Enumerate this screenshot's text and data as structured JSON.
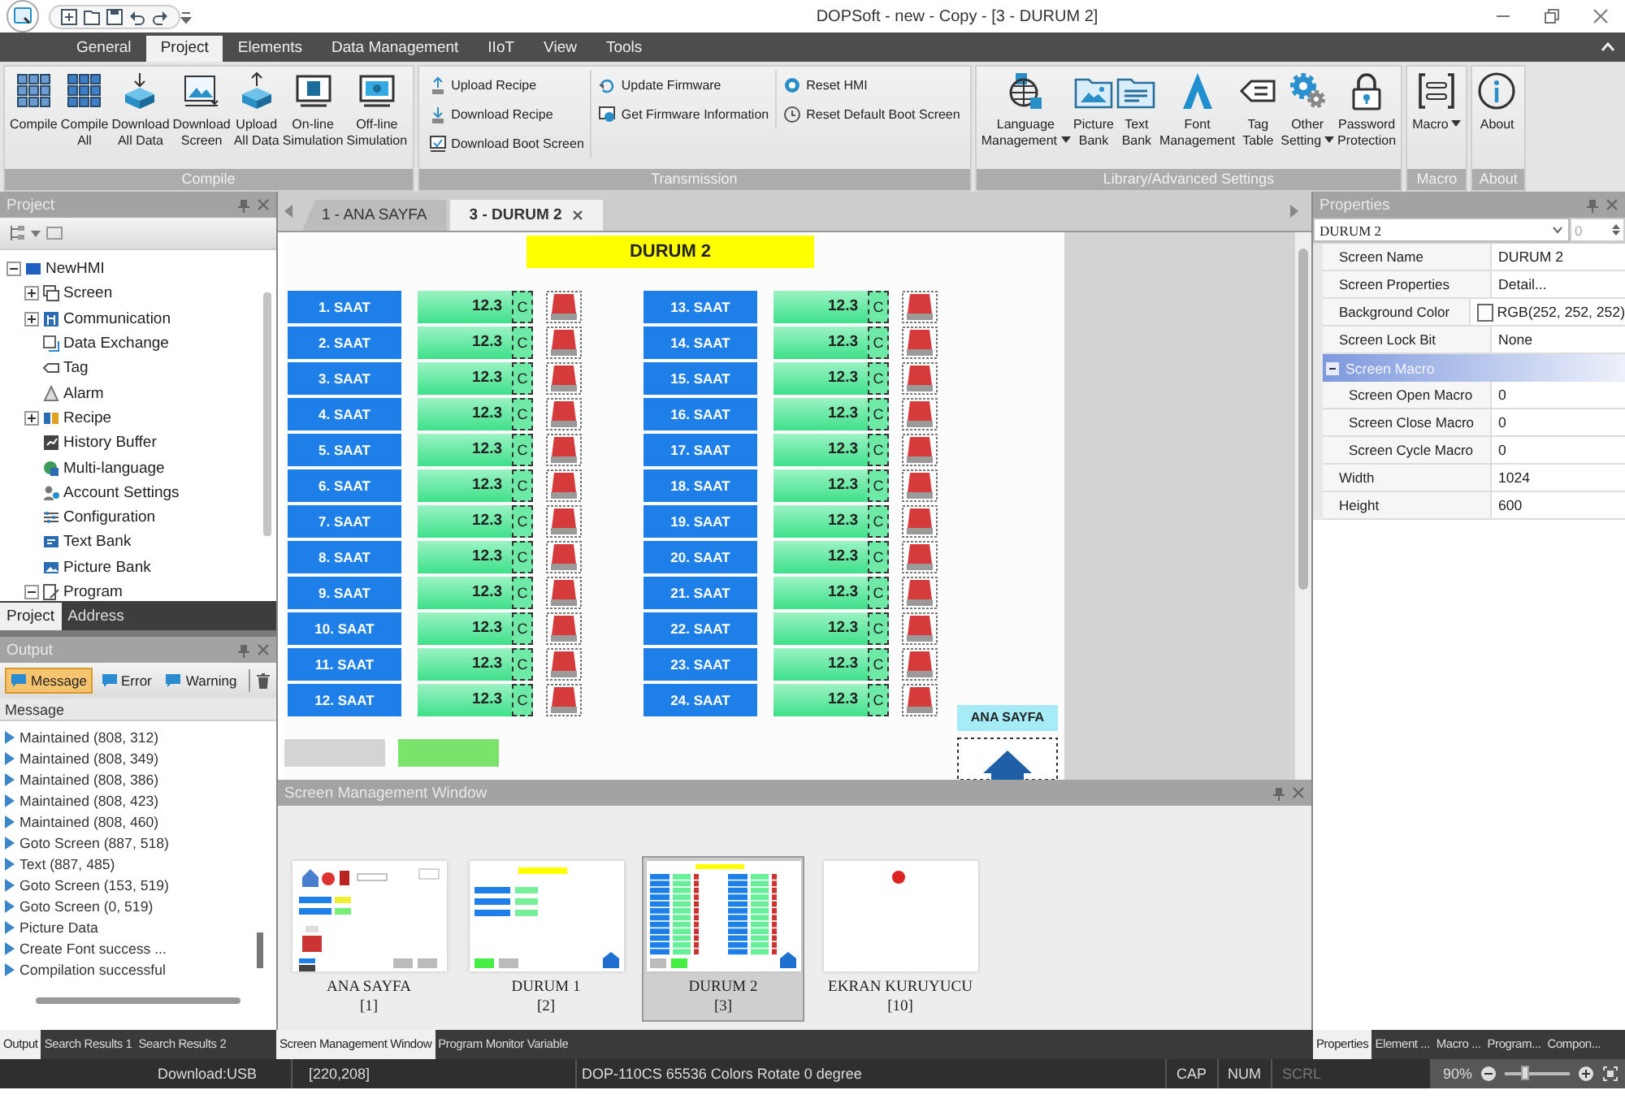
{
  "window": {
    "title": "DOPSoft - new - Copy - [3 - DURUM 2]"
  },
  "menu_tabs": [
    {
      "label": "General",
      "selected": false
    },
    {
      "label": "Project",
      "selected": true
    },
    {
      "label": "Elements",
      "selected": false
    },
    {
      "label": "Data Management",
      "selected": false
    },
    {
      "label": "IIoT",
      "selected": false
    },
    {
      "label": "View",
      "selected": false
    },
    {
      "label": "Tools",
      "selected": false
    }
  ],
  "ribbon": [
    {
      "title": "Compile",
      "kind": "large",
      "buttons": [
        {
          "label": "Compile",
          "dropdown": false
        },
        {
          "label": "Compile\nAll",
          "dropdown": false
        },
        {
          "label": "Download\nAll Data",
          "dropdown": false
        },
        {
          "label": "Download\nScreen",
          "dropdown": false
        },
        {
          "label": "Upload\nAll Data",
          "dropdown": false
        },
        {
          "label": "On-line\nSimulation",
          "dropdown": false
        },
        {
          "label": "Off-line\nSimulation",
          "dropdown": false
        }
      ]
    },
    {
      "title": "Transmission",
      "kind": "small",
      "columns": [
        [
          {
            "label": "Upload Recipe"
          },
          {
            "label": "Download Recipe"
          },
          {
            "label": "Download Boot Screen"
          }
        ],
        [
          {
            "label": "Update Firmware"
          },
          {
            "label": "Get Firmware Information"
          }
        ],
        [
          {
            "label": "Reset HMI"
          },
          {
            "label": "Reset Default Boot Screen"
          }
        ]
      ]
    },
    {
      "title": "Library/Advanced Settings",
      "kind": "large",
      "buttons": [
        {
          "label": "Language\nManagement",
          "dropdown": true
        },
        {
          "label": "Picture\nBank",
          "dropdown": false
        },
        {
          "label": "Text\nBank",
          "dropdown": false
        },
        {
          "label": "Font\nManagement",
          "dropdown": false
        },
        {
          "label": "Tag\nTable",
          "dropdown": false
        },
        {
          "label": "Other\nSetting",
          "dropdown": true
        },
        {
          "label": "Password\nProtection",
          "dropdown": false
        }
      ]
    },
    {
      "title": "Macro",
      "kind": "large",
      "buttons": [
        {
          "label": "Macro",
          "dropdown": true
        }
      ]
    },
    {
      "title": "About",
      "kind": "large",
      "buttons": [
        {
          "label": "About",
          "dropdown": false
        }
      ]
    }
  ],
  "project": {
    "title": "Project",
    "tree": [
      {
        "label": "NewHMI",
        "kind": "folder",
        "expanded": true,
        "children": [
          {
            "label": "Screen",
            "kind": "folder",
            "expanded": false
          },
          {
            "label": "Communication",
            "kind": "folder",
            "expanded": false
          },
          {
            "label": "Data Exchange",
            "kind": "leaf"
          },
          {
            "label": "Tag",
            "kind": "leaf"
          },
          {
            "label": "Alarm",
            "kind": "leaf"
          },
          {
            "label": "Recipe",
            "kind": "folder",
            "expanded": false
          },
          {
            "label": "History Buffer",
            "kind": "leaf"
          },
          {
            "label": "Multi-language",
            "kind": "leaf"
          },
          {
            "label": "Account Settings",
            "kind": "leaf"
          },
          {
            "label": "Configuration",
            "kind": "leaf"
          },
          {
            "label": "Text Bank",
            "kind": "leaf"
          },
          {
            "label": "Picture Bank",
            "kind": "leaf"
          },
          {
            "label": "Program",
            "kind": "folder",
            "expanded": true
          }
        ]
      }
    ]
  },
  "left_tabs": [
    {
      "label": "Project",
      "selected": true
    },
    {
      "label": "Address",
      "selected": false
    }
  ],
  "output": {
    "title": "Output",
    "filters": [
      {
        "label": "Message",
        "selected": true
      },
      {
        "label": "Error",
        "selected": false
      },
      {
        "label": "Warning",
        "selected": false
      }
    ],
    "column": "Message",
    "messages": [
      "Maintained (808, 312)",
      "Maintained (808, 349)",
      "Maintained (808, 386)",
      "Maintained (808, 423)",
      "Maintained (808, 460)",
      "Goto Screen (887, 518)",
      "Text (887, 485)",
      "Goto Screen (153, 519)",
      "Goto Screen (0, 519)",
      "Picture Data",
      "Create Font success ...",
      "Compilation successful"
    ]
  },
  "document_tabs": [
    {
      "label": "1 - ANA SAYFA",
      "selected": false
    },
    {
      "label": "3 - DURUM 2",
      "selected": true
    }
  ],
  "hmi": {
    "title": "DURUM 2",
    "nav_label": "ANA SAYFA",
    "rows": [
      {
        "label": "1. SAAT",
        "value": "12.3",
        "unit": "C"
      },
      {
        "label": "2. SAAT",
        "value": "12.3",
        "unit": "C"
      },
      {
        "label": "3. SAAT",
        "value": "12.3",
        "unit": "C"
      },
      {
        "label": "4. SAAT",
        "value": "12.3",
        "unit": "C"
      },
      {
        "label": "5. SAAT",
        "value": "12.3",
        "unit": "C"
      },
      {
        "label": "6. SAAT",
        "value": "12.3",
        "unit": "C"
      },
      {
        "label": "7. SAAT",
        "value": "12.3",
        "unit": "C"
      },
      {
        "label": "8. SAAT",
        "value": "12.3",
        "unit": "C"
      },
      {
        "label": "9. SAAT",
        "value": "12.3",
        "unit": "C"
      },
      {
        "label": "10. SAAT",
        "value": "12.3",
        "unit": "C"
      },
      {
        "label": "11. SAAT",
        "value": "12.3",
        "unit": "C"
      },
      {
        "label": "12. SAAT",
        "value": "12.3",
        "unit": "C"
      },
      {
        "label": "13. SAAT",
        "value": "12.3",
        "unit": "C"
      },
      {
        "label": "14. SAAT",
        "value": "12.3",
        "unit": "C"
      },
      {
        "label": "15. SAAT",
        "value": "12.3",
        "unit": "C"
      },
      {
        "label": "16. SAAT",
        "value": "12.3",
        "unit": "C"
      },
      {
        "label": "17. SAAT",
        "value": "12.3",
        "unit": "C"
      },
      {
        "label": "18. SAAT",
        "value": "12.3",
        "unit": "C"
      },
      {
        "label": "19. SAAT",
        "value": "12.3",
        "unit": "C"
      },
      {
        "label": "20. SAAT",
        "value": "12.3",
        "unit": "C"
      },
      {
        "label": "21. SAAT",
        "value": "12.3",
        "unit": "C"
      },
      {
        "label": "22. SAAT",
        "value": "12.3",
        "unit": "C"
      },
      {
        "label": "23. SAAT",
        "value": "12.3",
        "unit": "C"
      },
      {
        "label": "24. SAAT",
        "value": "12.3",
        "unit": "C"
      }
    ]
  },
  "screen_manager": {
    "title": "Screen Management Window",
    "screens": [
      {
        "name": "ANA SAYFA",
        "number": "[1]",
        "kind": "home",
        "selected": false
      },
      {
        "name": "DURUM 1",
        "number": "[2]",
        "kind": "list",
        "selected": false
      },
      {
        "name": "DURUM 2",
        "number": "[3]",
        "kind": "grid",
        "selected": true
      },
      {
        "name": "EKRAN KURUYUCU",
        "number": "[10]",
        "kind": "blank",
        "selected": false
      }
    ]
  },
  "properties": {
    "title": "Properties",
    "object": "DURUM 2",
    "spin": "0",
    "rows": [
      {
        "kind": "prop",
        "name": "Screen Name",
        "value": "DURUM 2"
      },
      {
        "kind": "prop",
        "name": "Screen Properties",
        "value": "Detail..."
      },
      {
        "kind": "prop",
        "name": "Background Color",
        "value": "RGB(252, 252, 252)",
        "swatch": true
      },
      {
        "kind": "prop",
        "name": "Screen Lock Bit",
        "value": "None"
      },
      {
        "kind": "category",
        "name": "Screen Macro",
        "expanded": true,
        "children": [
          {
            "name": "Screen Open Macro",
            "value": "0"
          },
          {
            "name": "Screen Close Macro",
            "value": "0"
          },
          {
            "name": "Screen Cycle Macro",
            "value": "0"
          }
        ]
      },
      {
        "kind": "prop",
        "name": "Width",
        "value": "1024"
      },
      {
        "kind": "prop",
        "name": "Height",
        "value": "600"
      }
    ]
  },
  "bottom_tabs": [
    [
      {
        "label": "Output",
        "selected": true
      },
      {
        "label": "Search Results 1",
        "selected": false
      },
      {
        "label": "Search Results 2",
        "selected": false
      }
    ],
    [
      {
        "label": "Screen Management Window",
        "selected": true
      },
      {
        "label": "Program Monitor Variable",
        "selected": false
      }
    ],
    [
      {
        "label": "Properties",
        "selected": true
      },
      {
        "label": "Element ...",
        "selected": false
      },
      {
        "label": "Macro ...",
        "selected": false
      },
      {
        "label": "Program...",
        "selected": false
      },
      {
        "label": "Compon...",
        "selected": false
      }
    ]
  ],
  "status": {
    "port": "Download:USB",
    "coords": "[220,208]",
    "device": "DOP-110CS 65536 Colors Rotate 0 degree",
    "keys": [
      {
        "label": "CAP",
        "on": true
      },
      {
        "label": "NUM",
        "on": true
      },
      {
        "label": "SCRL",
        "on": false
      }
    ],
    "zoom": {
      "label": "90%",
      "level": 0.3
    }
  }
}
